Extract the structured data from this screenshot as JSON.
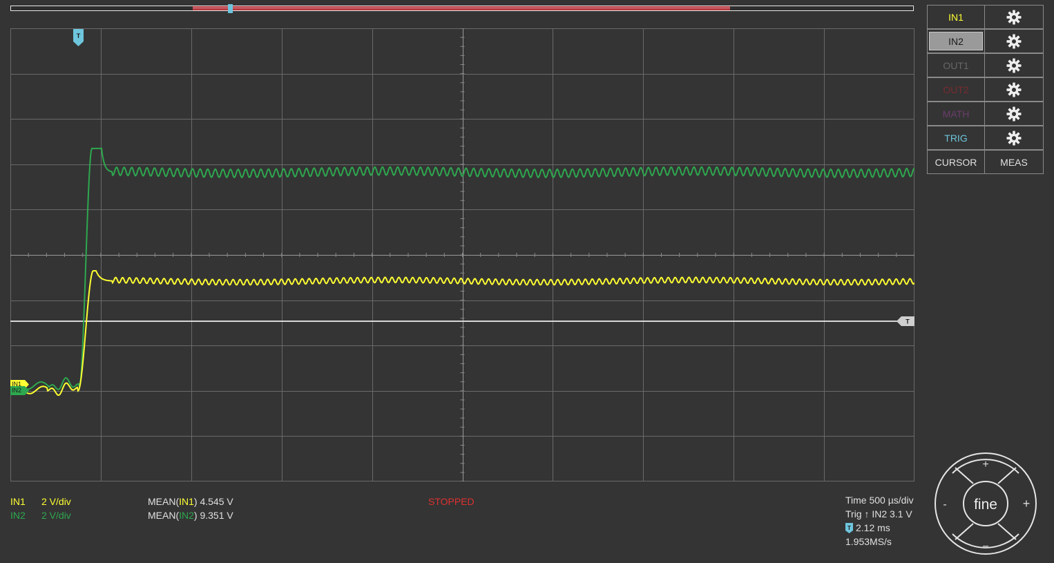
{
  "colors": {
    "in1": "#ffff33",
    "in2": "#2ea84f",
    "out1": "#666666",
    "out2": "#7a2a2f",
    "math": "#6a3d6a",
    "trig": "#6ec6dd",
    "stopped": "#e03030",
    "grid": "#6a6a6a",
    "background": "#343434"
  },
  "markers": {
    "trigger_time": "T",
    "trigger_level": "T",
    "in1": "IN1",
    "in2": "IN2"
  },
  "panel": {
    "rows": [
      {
        "label": "IN1",
        "color": "#ffff33",
        "selected": false,
        "icon": "gear-icon"
      },
      {
        "label": "IN2",
        "color": "#1a1a1a",
        "selected": true,
        "icon": "gear-icon"
      },
      {
        "label": "OUT1",
        "color": "#666666",
        "selected": false,
        "icon": "gear-icon"
      },
      {
        "label": "OUT2",
        "color": "#7a2a2f",
        "selected": false,
        "icon": "gear-icon"
      },
      {
        "label": "MATH",
        "color": "#6a3d6a",
        "selected": false,
        "icon": "gear-icon"
      },
      {
        "label": "TRIG",
        "color": "#6ec6dd",
        "selected": false,
        "icon": "gear-icon"
      }
    ],
    "cursor_label": "CURSOR",
    "meas_label": "MEAS"
  },
  "channels": [
    {
      "name": "IN1",
      "scale": "2 V/div",
      "color": "#ffff33"
    },
    {
      "name": "IN2",
      "scale": "2 V/div",
      "color": "#2ea84f"
    }
  ],
  "measurements": [
    {
      "prefix": "MEAN(",
      "channel": "IN1",
      "suffix": ") 4.545 V"
    },
    {
      "prefix": "MEAN(",
      "channel": "IN2",
      "suffix": ") 9.351 V"
    }
  ],
  "status": "STOPPED",
  "timebase": {
    "time": "Time 500 µs/div",
    "trig_prefix": "Trig",
    "trig_arrow": "↑",
    "trig_value": "IN2 3.1 V",
    "trig_offset": "2.12 ms",
    "sample_rate": "1.953MS/s"
  },
  "jog": {
    "center_label": "fine",
    "up": "+",
    "down": "−",
    "left": "-",
    "right": "+"
  },
  "signals": {
    "in1": {
      "pre_level_v": -0.3,
      "overshoot_v": 5.0,
      "steady_v": 4.545
    },
    "in2": {
      "pre_level_v": -0.1,
      "overshoot_v": 10.4,
      "steady_v": 9.351
    }
  }
}
